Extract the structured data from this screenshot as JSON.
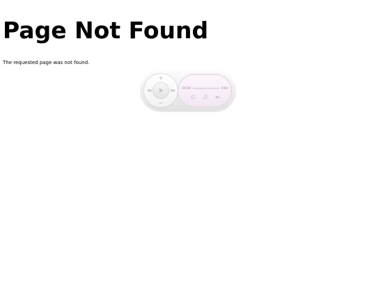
{
  "page": {
    "title": "Page Not Found",
    "message": "The requested page was not found."
  },
  "player": {
    "time_current": "00:00",
    "time_total": "0:00",
    "progress": 0,
    "icons": {
      "volume_up": "plus-icon",
      "volume_down": "minus-icon",
      "previous": "previous-track-icon",
      "next": "next-track-icon",
      "play": "play-icon",
      "repeat": "repeat-icon",
      "playlist": "music-note-icon",
      "mute": "speaker-mute-icon"
    },
    "colors": {
      "icon": "#c4c4c4",
      "screen": "#f4e6f5",
      "body": "#ececec"
    }
  }
}
